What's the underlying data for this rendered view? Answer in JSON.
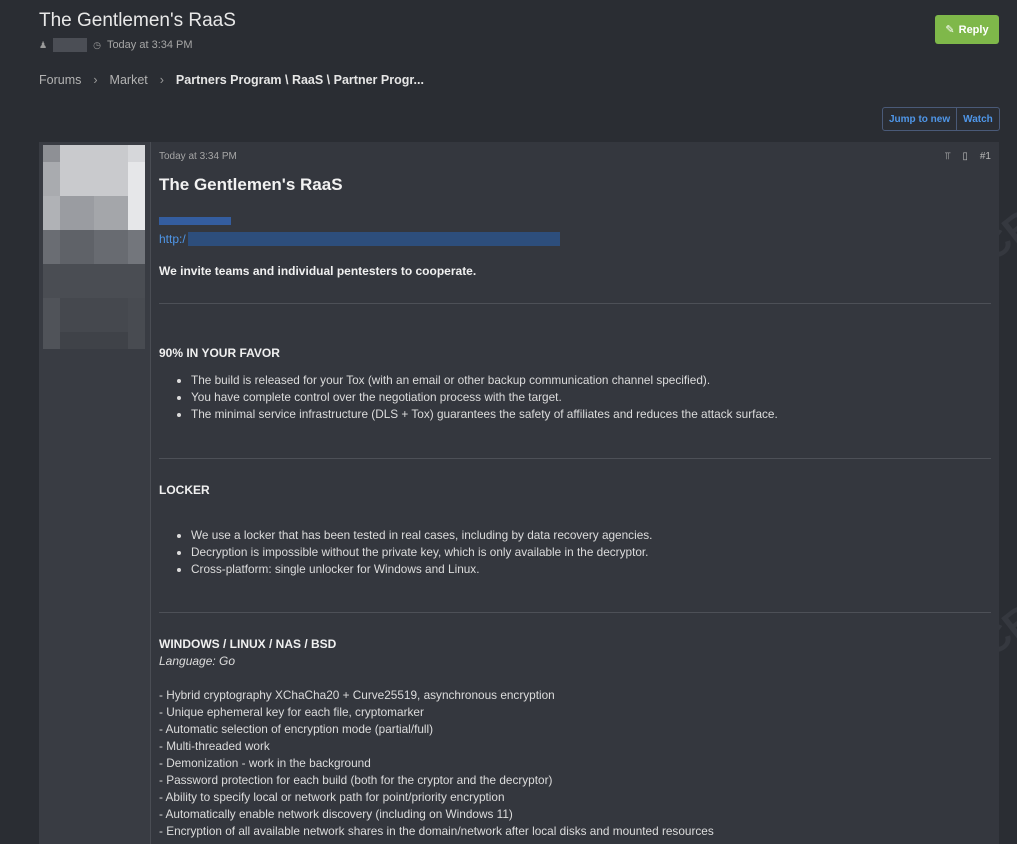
{
  "thread": {
    "title": "The Gentlemen's RaaS",
    "time": "Today at 3:34 PM",
    "reply_label": "Reply"
  },
  "breadcrumb": {
    "items": [
      "Forums",
      "Market"
    ],
    "current": "Partners Program \\ RaaS \\ Partner Progr..."
  },
  "actions": {
    "jump_label": "Jump to new",
    "watch_label": "Watch"
  },
  "post": {
    "time": "Today at 3:34 PM",
    "number": "#1",
    "title": "The Gentlemen's RaaS",
    "link_prefix": "http:/",
    "intro": "We invite teams and individual pentesters to cooperate.",
    "sections": [
      {
        "heading": "90% IN YOUR FAVOR",
        "bullets": [
          "The build is released for your Tox (with an email or other backup communication channel specified).",
          "You have complete control over the negotiation process with the target.",
          "The minimal service infrastructure (DLS + Tox) guarantees the safety of affiliates and reduces the attack surface."
        ]
      },
      {
        "heading": "LOCKER",
        "bullets": [
          "We use a locker that has been tested in real cases, including by data recovery agencies.",
          "Decryption is impossible without the private key, which is only available in the decryptor.",
          "Cross-platform: single unlocker for Windows and Linux."
        ]
      },
      {
        "heading": "WINDOWS / LINUX / NAS / BSD",
        "language": "Language: Go",
        "features": [
          "- Hybrid cryptography XChaCha20 + Curve25519, asynchronous encryption",
          "- Unique ephemeral key for each file, cryptomarker",
          "- Automatic selection of encryption mode (partial/full)",
          "- Multi-threaded work",
          "- Demonization - work in the background",
          "- Password protection for each build (both for the cryptor and the decryptor)",
          "- Ability to specify local or network path for point/priority encryption",
          "- Automatically enable network discovery (including on Windows 11)",
          "- Encryption of all available network shares in the domain/network after local disks and mounted resources"
        ]
      }
    ]
  },
  "watermark": "SOCRadar",
  "colors": {
    "background": "#2a2d33",
    "post_bg": "#34373e",
    "accent_link": "#4f96e8",
    "reply_green": "#7fb84a"
  }
}
